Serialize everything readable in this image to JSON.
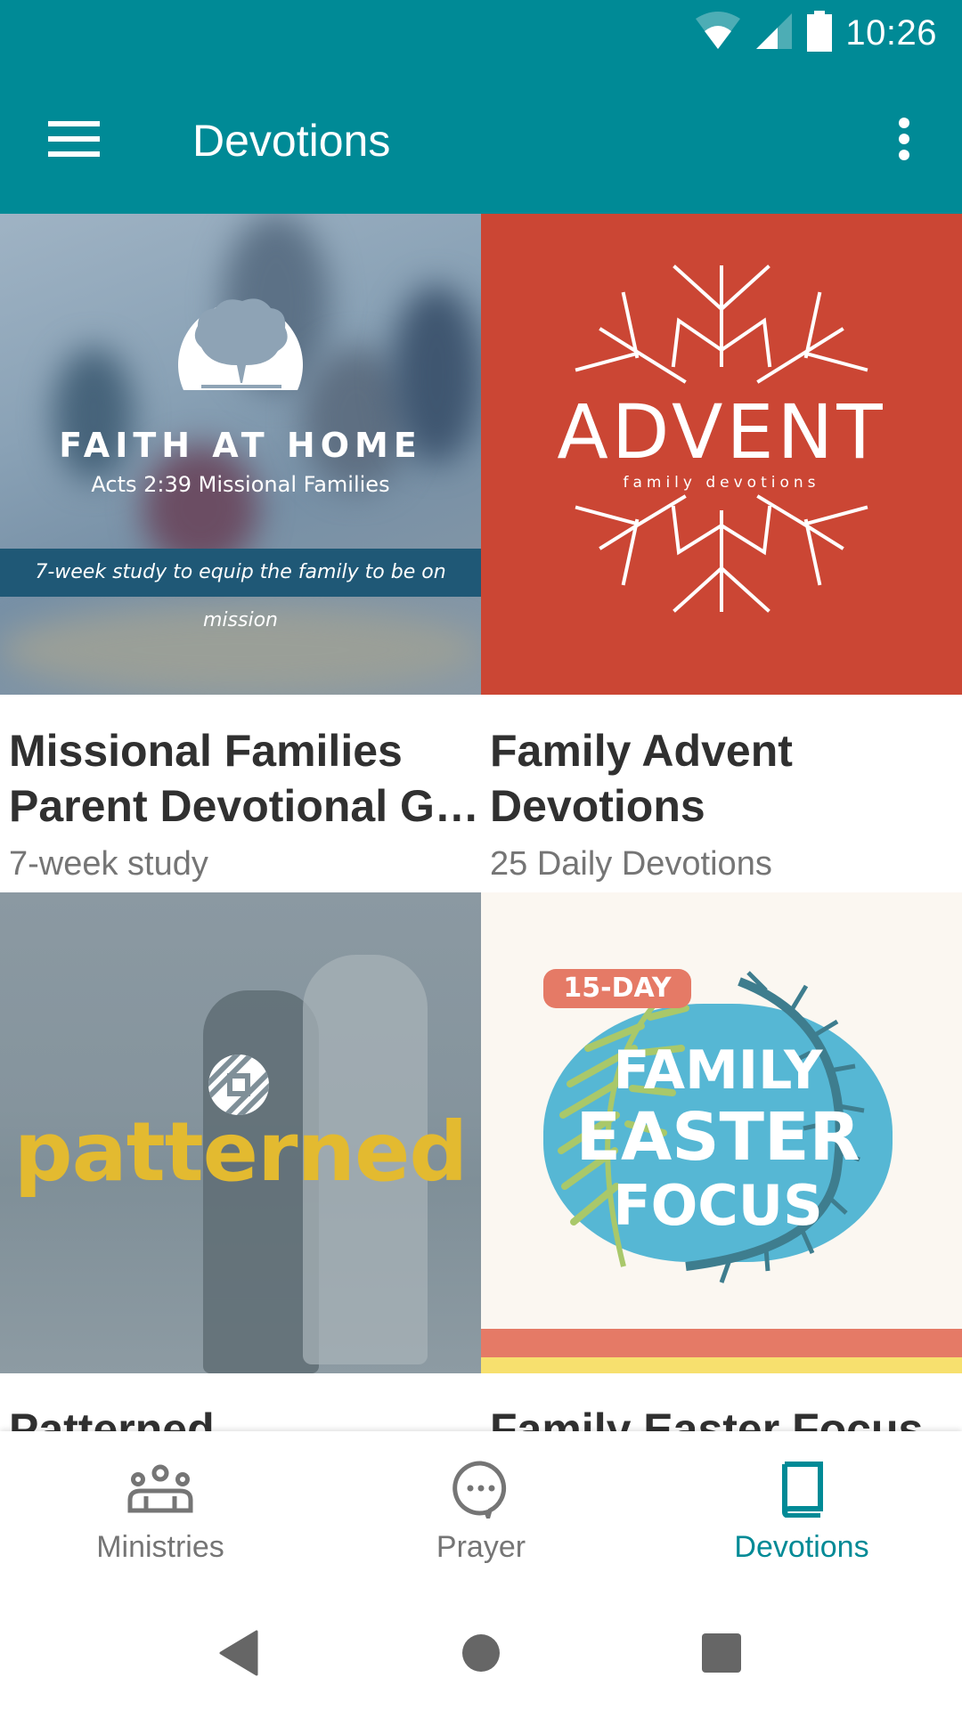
{
  "status_bar": {
    "time": "10:26",
    "icons": [
      "wifi-icon",
      "cell-signal-icon",
      "battery-icon"
    ]
  },
  "toolbar": {
    "title": "Devotions",
    "menu_icon": "hamburger-menu-icon",
    "overflow_icon": "more-vert-icon"
  },
  "colors": {
    "primary": "#008A96",
    "title_text": "#303030",
    "subtitle_text": "#757575",
    "inactive_nav": "#757575"
  },
  "devotions": [
    {
      "title": "Missional Families Parent Devotional Guide",
      "title_display": "Missional Families Parent Devotional G…",
      "subtitle": "7-week study",
      "image": {
        "brand": "FAITH AT HOME",
        "brand_sub": "Acts 2:39 Missional Families",
        "banner": "7-week study to equip the family to be on mission"
      }
    },
    {
      "title": "Family Advent Devotions",
      "title_display": "Family Advent Devotions",
      "subtitle": "25 Daily Devotions",
      "image": {
        "title": "ADVENT",
        "sub": "family devotions"
      }
    },
    {
      "title": "Patterned",
      "title_display": "Patterned",
      "subtitle": "",
      "image": {
        "word": "patterned"
      }
    },
    {
      "title": "Family Easter Focus",
      "title_display": "Family Easter Focus",
      "subtitle": "",
      "image": {
        "badge": "15-DAY",
        "line1": "FAMILY",
        "line2": "EASTER",
        "line3": "FOCUS"
      }
    }
  ],
  "bottom_nav": {
    "items": [
      {
        "label": "Ministries",
        "icon": "groups-icon",
        "active": false
      },
      {
        "label": "Prayer",
        "icon": "chat-bubble-icon",
        "active": false
      },
      {
        "label": "Devotions",
        "icon": "book-icon",
        "active": true
      }
    ]
  },
  "system_nav": {
    "buttons": [
      "back-icon",
      "home-icon",
      "recents-icon"
    ]
  }
}
